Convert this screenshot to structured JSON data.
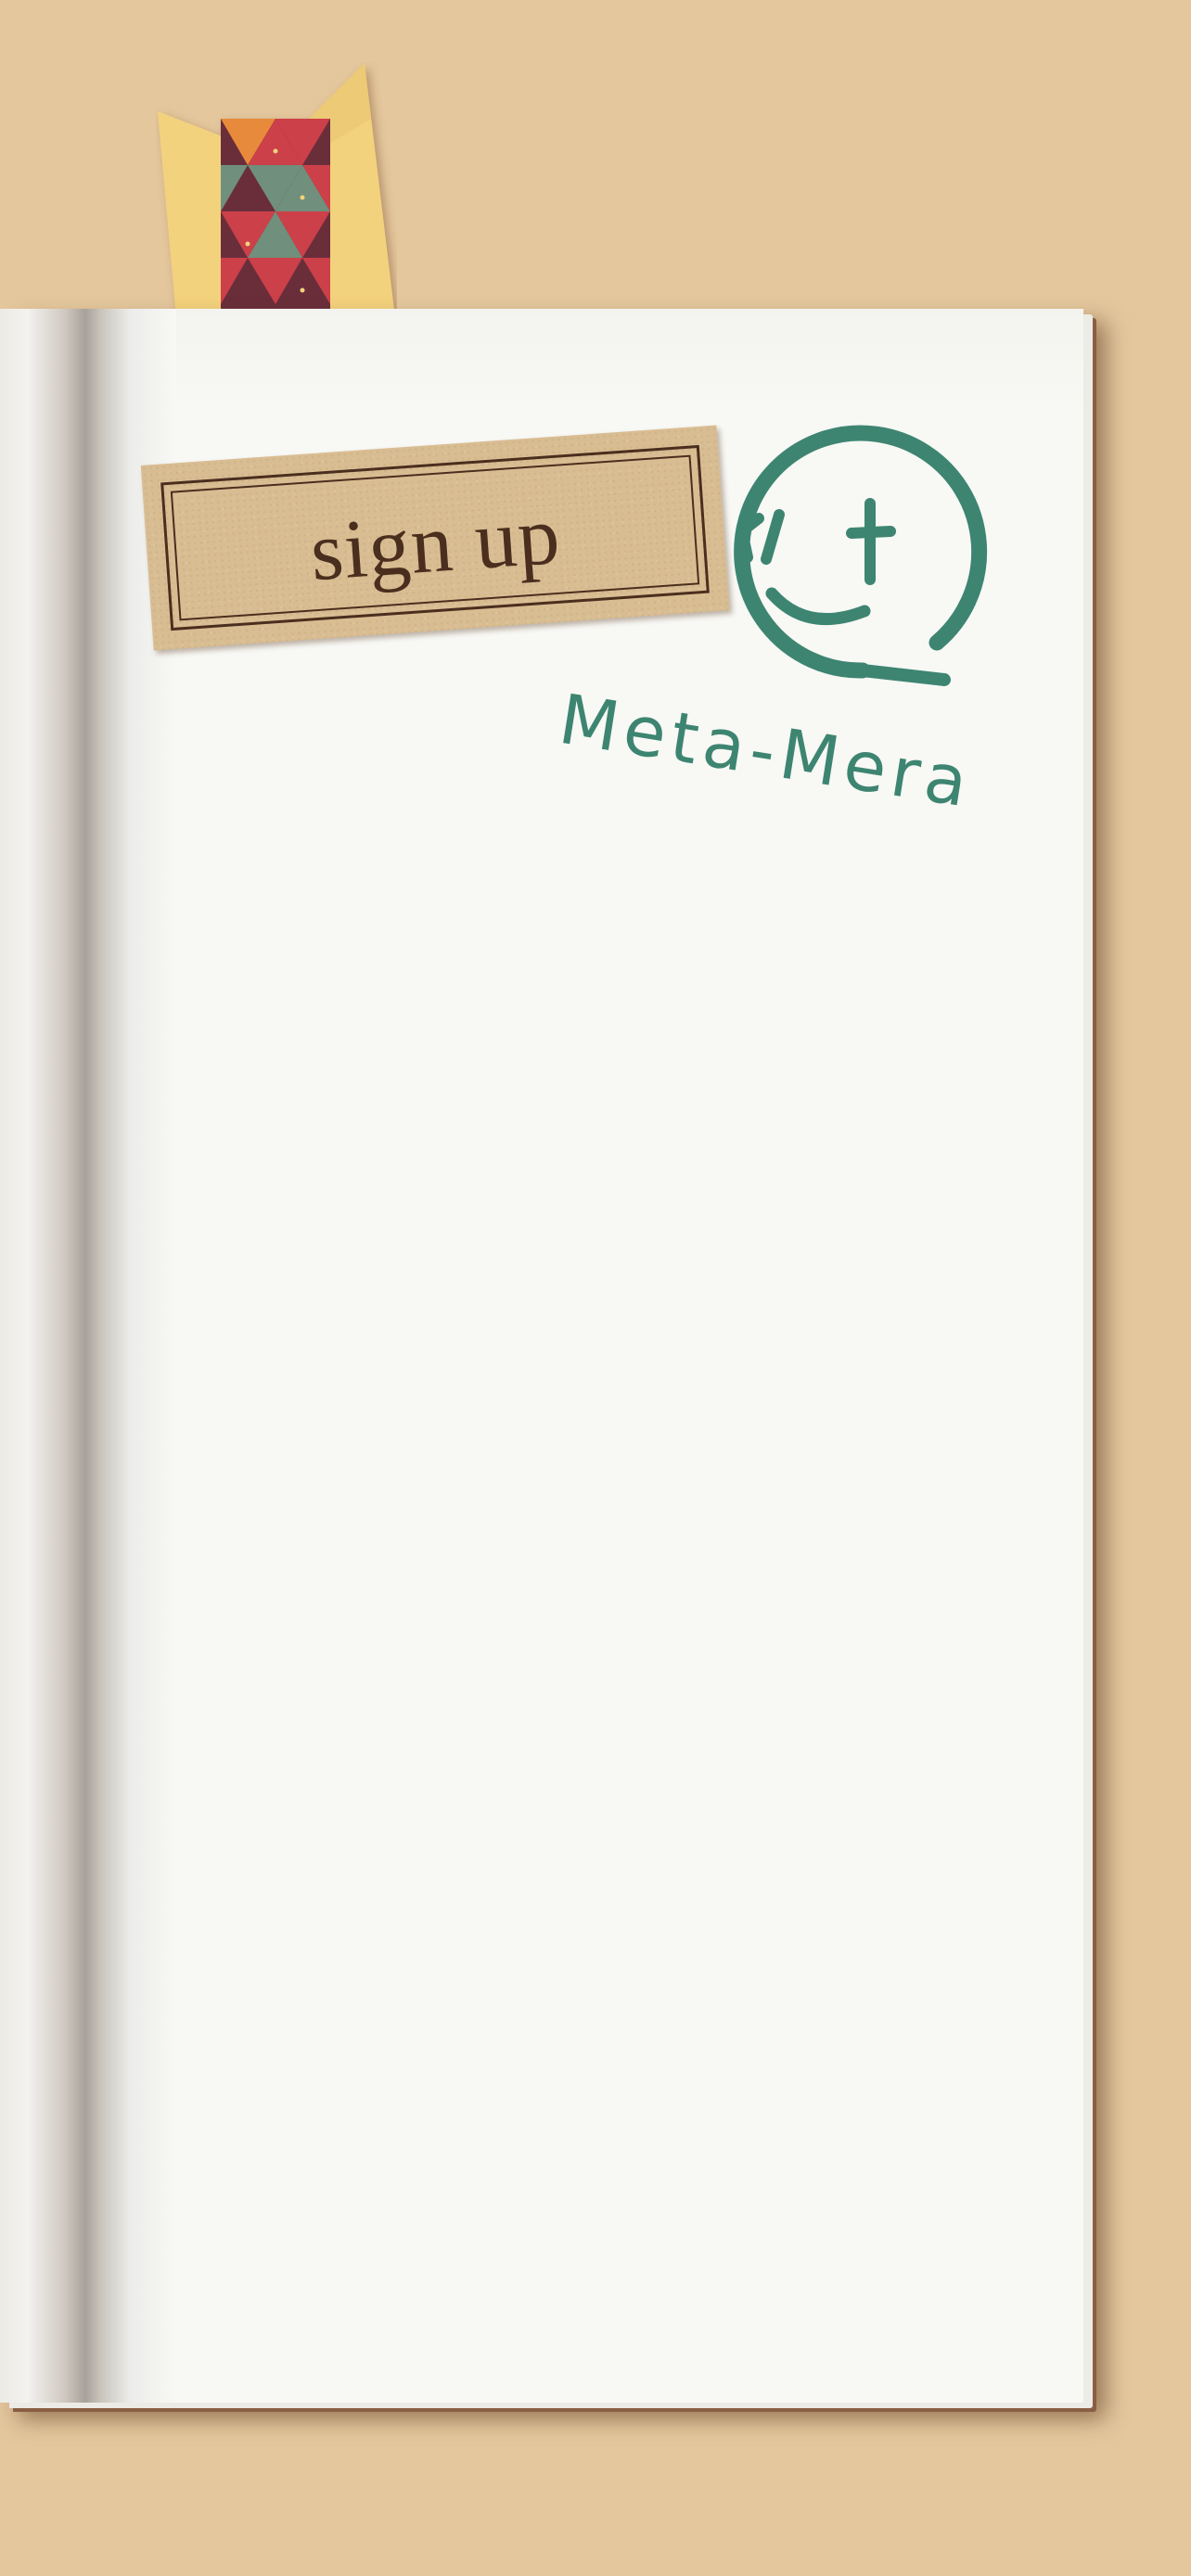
{
  "signup": {
    "label": "sign up"
  },
  "logo": {
    "wordmark": "Meta-Mera",
    "icon": "smiley-speech-bubble-icon",
    "color": "#3d8571"
  },
  "bookmark": {
    "icon": "triangle-pattern-ribbon",
    "colors": [
      "#f3d27d",
      "#cc3f48",
      "#6f8f7b",
      "#6b2e3a",
      "#e78a3b"
    ]
  },
  "theme": {
    "background": "#e4c79d",
    "paper": "#f8f8f5",
    "ink": "#4a2e1e"
  }
}
